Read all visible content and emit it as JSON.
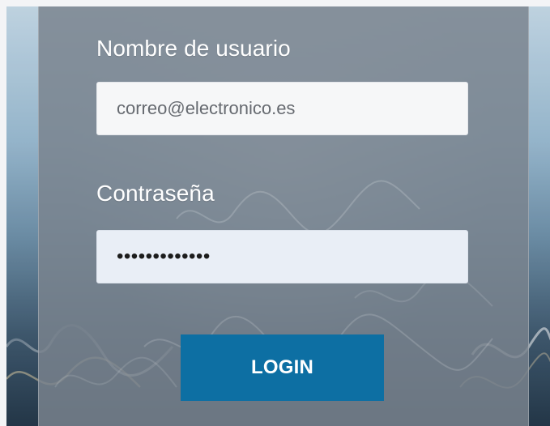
{
  "login_form": {
    "username_label": "Nombre de usuario",
    "username_value": "correo@electronico.es",
    "password_label": "Contraseña",
    "password_value": "•••••••••••••",
    "login_button": "LOGIN"
  },
  "colors": {
    "panel_overlay": "#7a838e",
    "field_bg": "#f6f7f8",
    "password_bg": "#e9eef6",
    "button_bg": "#0d6fa3",
    "button_text": "#ffffff"
  }
}
